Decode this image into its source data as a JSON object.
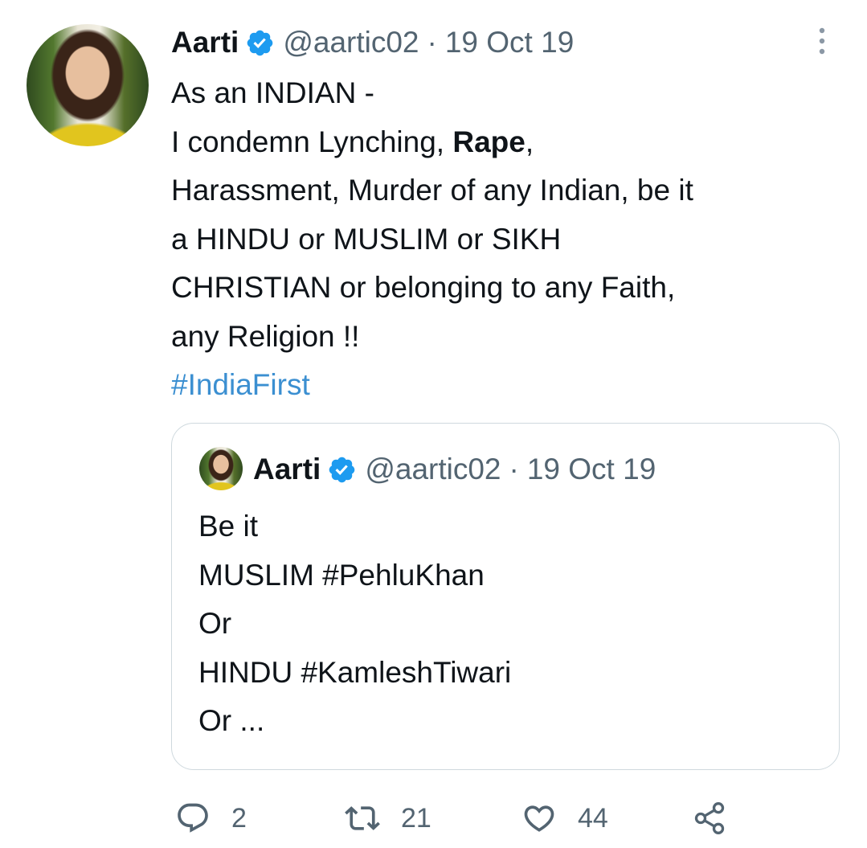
{
  "tweet": {
    "author_name": "Aarti",
    "handle": "@aartic02",
    "separator": "·",
    "date": "19 Oct 19",
    "lines": [
      "As an INDIAN -",
      "I condemn Lynching, ",
      "Rape",
      ",",
      "Harassment, Murder of any Indian, be it",
      "a HINDU or MUSLIM or SIKH",
      "CHRISTIAN or belonging to any Faith,",
      "any Religion !!"
    ],
    "hashtag": "#IndiaFirst"
  },
  "quoted_tweet": {
    "author_name": "Aarti",
    "handle": "@aartic02",
    "separator": "·",
    "date": "19 Oct 19",
    "lines": [
      "Be it",
      "MUSLIM #PehluKhan",
      "Or",
      "HINDU #KamleshTiwari",
      "Or ..."
    ]
  },
  "actions": {
    "replies": "2",
    "retweets": "21",
    "likes": "44"
  },
  "icons": {
    "reply": "reply-icon",
    "retweet": "retweet-icon",
    "like": "heart-icon",
    "share": "share-icon",
    "more": "more-vertical-icon",
    "verified": "verified-badge-icon"
  },
  "colors": {
    "verified": "#1d9bf0",
    "hashtag": "#3b8fd1",
    "muted": "#536471"
  }
}
